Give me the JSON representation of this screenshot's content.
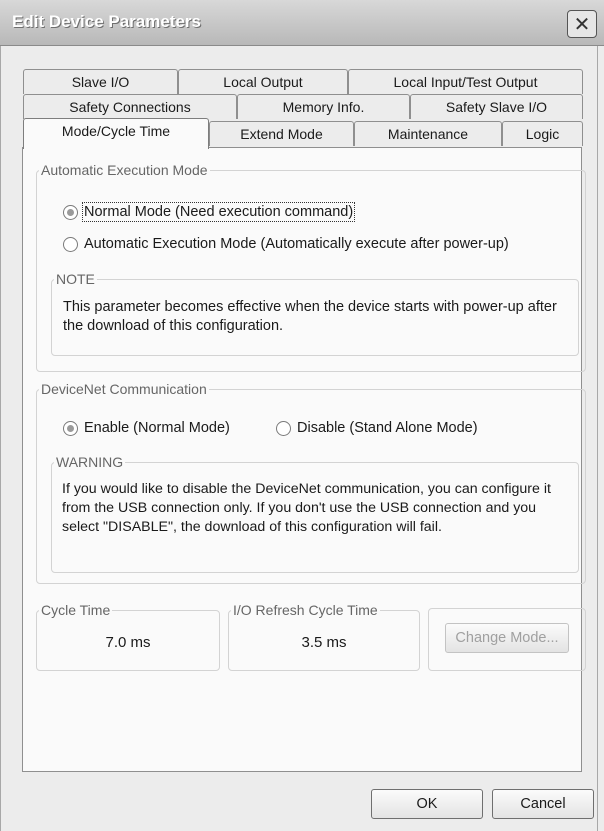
{
  "window": {
    "title": "Edit Device Parameters",
    "close_glyph": "✕"
  },
  "tabs": {
    "row1": [
      {
        "label": "Slave I/O"
      },
      {
        "label": "Local Output"
      },
      {
        "label": "Local Input/Test Output"
      }
    ],
    "row2": [
      {
        "label": "Safety Connections"
      },
      {
        "label": "Memory Info."
      },
      {
        "label": "Safety Slave I/O"
      }
    ],
    "row3": [
      {
        "label": "Mode/Cycle Time",
        "active": true
      },
      {
        "label": "Extend Mode"
      },
      {
        "label": "Maintenance"
      },
      {
        "label": "Logic"
      }
    ]
  },
  "auto_exec": {
    "legend": "Automatic Execution Mode",
    "normal_label": "Normal Mode (Need execution command)",
    "normal_checked": true,
    "auto_label": "Automatic Execution Mode (Automatically execute after power-up)",
    "note_legend": "NOTE",
    "note_text": "This parameter becomes effective when the device starts with power-up after the download of this configuration."
  },
  "devicenet": {
    "legend": "DeviceNet Communication",
    "enable_label": "Enable (Normal Mode)",
    "enable_checked": true,
    "disable_label": "Disable (Stand Alone Mode)",
    "warning_legend": "WARNING",
    "warning_text": "If you would like to disable the DeviceNet communication, you can configure it from the USB connection only. If you don't use the USB connection and you select \"DISABLE\", the download of this configuration will fail."
  },
  "cycle": {
    "cycle_legend": "Cycle Time",
    "cycle_value": "7.0 ms",
    "refresh_legend": "I/O Refresh Cycle Time",
    "refresh_value": "3.5 ms",
    "change_mode_label": "Change Mode...",
    "change_mode_enabled": false
  },
  "footer": {
    "ok_label": "OK",
    "cancel_label": "Cancel"
  }
}
